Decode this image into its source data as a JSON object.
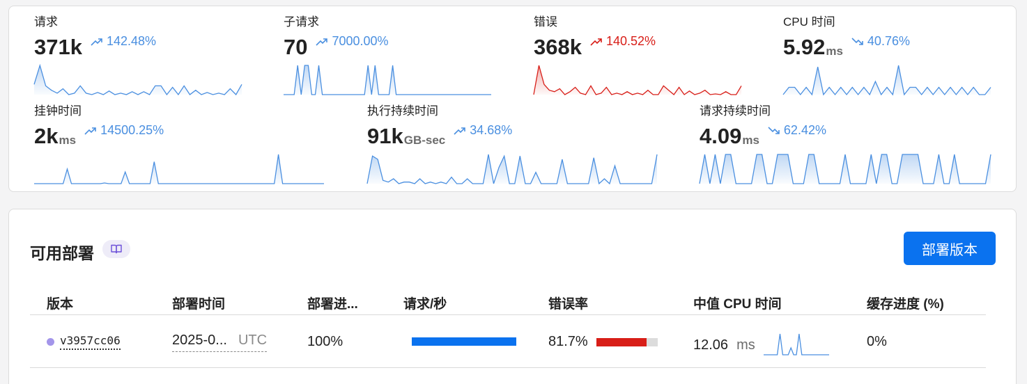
{
  "metrics": [
    {
      "title": "请求",
      "value": "371k",
      "unit": "",
      "change": "142.48%",
      "trend": "up",
      "color": "#4a8fe0",
      "spark": [
        14,
        40,
        12,
        6,
        2,
        8,
        0,
        2,
        12,
        2,
        0,
        3,
        0,
        5,
        0,
        2,
        0,
        4,
        0,
        4,
        0,
        12,
        12,
        0,
        10,
        0,
        12,
        0,
        6,
        0,
        3,
        0,
        2,
        0,
        8,
        0,
        14
      ]
    },
    {
      "title": "子请求",
      "value": "70",
      "unit": "",
      "change": "7000.00%",
      "trend": "up",
      "color": "#4a8fe0",
      "spark": [
        0,
        0,
        0,
        0,
        36,
        0,
        36,
        36,
        0,
        0,
        36,
        0,
        0,
        0,
        0,
        0,
        0,
        0,
        0,
        0,
        0,
        0,
        0,
        0,
        36,
        0,
        36,
        0,
        0,
        0,
        0,
        36,
        0,
        0,
        0,
        0,
        0,
        0,
        0,
        0,
        0,
        0,
        0,
        0,
        0,
        0,
        0,
        0,
        0,
        0,
        0,
        0,
        0,
        0,
        0,
        0,
        0,
        0,
        0,
        0
      ]
    },
    {
      "title": "错误",
      "value": "368k",
      "unit": "",
      "change": "140.52%",
      "trend": "up",
      "color": "#d81e18",
      "spark": [
        0,
        40,
        14,
        6,
        4,
        8,
        0,
        4,
        10,
        2,
        0,
        12,
        0,
        2,
        10,
        0,
        2,
        0,
        4,
        0,
        2,
        0,
        6,
        0,
        0,
        12,
        6,
        0,
        10,
        0,
        5,
        0,
        2,
        6,
        0,
        1,
        0,
        4,
        0,
        0,
        12
      ]
    },
    {
      "title": "CPU 时间",
      "value": "5.92",
      "unit": "ms",
      "change": "40.76%",
      "trend": "down",
      "color": "#4a8fe0",
      "spark": [
        0,
        10,
        10,
        0,
        10,
        0,
        38,
        0,
        10,
        0,
        10,
        0,
        10,
        0,
        10,
        0,
        18,
        0,
        10,
        0,
        40,
        0,
        10,
        10,
        0,
        10,
        0,
        10,
        0,
        10,
        0,
        10,
        0,
        10,
        0,
        0,
        10
      ]
    },
    {
      "title": "挂钟时间",
      "value": "2k",
      "unit": "ms",
      "change": "14500.25%",
      "trend": "up",
      "color": "#4a8fe0",
      "spark": [
        0,
        0,
        0,
        0,
        0,
        0,
        0,
        0,
        20,
        0,
        0,
        0,
        0,
        0,
        0,
        0,
        0,
        1,
        0,
        0,
        0,
        0,
        16,
        0,
        0,
        0,
        0,
        0,
        0,
        30,
        0,
        0,
        0,
        0,
        0,
        0,
        0,
        0,
        0,
        0,
        0,
        0,
        0,
        0,
        0,
        0,
        0,
        0,
        0,
        0,
        0,
        0,
        0,
        0,
        0,
        0,
        0,
        0,
        0,
        40,
        0,
        0,
        0,
        0,
        0,
        0,
        0,
        0,
        0,
        0,
        0
      ]
    },
    {
      "title": "执行持续时间",
      "value": "91k",
      "unit": "GB-sec",
      "change": "34.68%",
      "trend": "up",
      "color": "#4a8fe0",
      "spark": [
        0,
        34,
        30,
        4,
        2,
        6,
        0,
        2,
        2,
        0,
        6,
        0,
        2,
        0,
        2,
        0,
        8,
        0,
        0,
        6,
        0,
        0,
        0,
        36,
        0,
        20,
        34,
        0,
        0,
        34,
        0,
        0,
        14,
        0,
        0,
        0,
        0,
        30,
        0,
        0,
        0,
        0,
        0,
        32,
        0,
        6,
        0,
        22,
        0,
        0,
        0,
        0,
        0,
        0,
        0,
        36
      ]
    },
    {
      "title": "请求持续时间",
      "value": "4.09",
      "unit": "ms",
      "change": "62.42%",
      "trend": "down",
      "color": "#4a8fe0",
      "spark": [
        0,
        40,
        0,
        40,
        0,
        40,
        40,
        0,
        0,
        0,
        0,
        40,
        40,
        0,
        0,
        40,
        40,
        40,
        0,
        0,
        0,
        40,
        40,
        0,
        0,
        0,
        0,
        0,
        40,
        0,
        0,
        0,
        0,
        40,
        0,
        40,
        40,
        0,
        0,
        40,
        40,
        40,
        40,
        0,
        0,
        0,
        40,
        0,
        0,
        40,
        0,
        0,
        0,
        0,
        0,
        0,
        40
      ]
    }
  ],
  "deployments": {
    "title": "可用部署",
    "book_icon": "book-icon",
    "button_label": "部署版本",
    "columns": [
      "版本",
      "部署时间",
      "部署进...",
      "请求/秒",
      "错误率",
      "中值 CPU 时间",
      "缓存进度 (%)"
    ],
    "rows": [
      {
        "version": "v3957cc06",
        "version_dot_color": "#a395ea",
        "deploy_time": "2025-0...",
        "timezone": "UTC",
        "progress": "100%",
        "requests_per_sec_fraction": 1.0,
        "error_rate": "81.7%",
        "error_rate_fraction": 0.817,
        "cpu_value": "12.06",
        "cpu_unit": "ms",
        "cpu_spark": [
          0,
          0,
          0,
          0,
          0,
          0,
          30,
          0,
          0,
          0,
          10,
          0,
          0,
          30,
          0,
          0,
          0,
          0,
          0,
          0,
          0,
          0,
          0,
          0,
          0
        ],
        "cache_progress": "0%"
      }
    ]
  },
  "colors": {
    "accent": "#0a72ef",
    "blue_line": "#4a8fe0",
    "red": "#d81e18"
  }
}
